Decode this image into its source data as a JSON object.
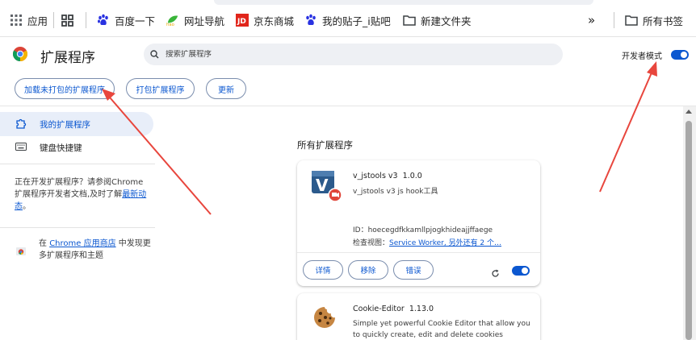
{
  "bookmarks_bar": {
    "items": [
      {
        "label": "应用"
      },
      {
        "label": ""
      },
      {
        "label": "百度一下"
      },
      {
        "label": "网址导航"
      },
      {
        "label": "京东商城"
      },
      {
        "label": "我的贴子_i贴吧"
      },
      {
        "label": "新建文件夹"
      }
    ],
    "overflow": "»",
    "all_bookmarks": "所有书签"
  },
  "header": {
    "title": "扩展程序",
    "search_placeholder": "搜索扩展程序",
    "dev_mode_label": "开发者模式",
    "dev_mode_on": true
  },
  "toolbar": {
    "load_unpacked": "加载未打包的扩展程序",
    "pack": "打包扩展程序",
    "update": "更新"
  },
  "sidebar": {
    "my_extensions": "我的扩展程序",
    "shortcuts": "键盘快捷键",
    "dev_text_1": "正在开发扩展程序？请参阅Chrome 扩展程序开发者文档,及时了解",
    "dev_link": "最新动态",
    "dev_text_2": "。",
    "store_text_1": "在",
    "store_link": "Chrome 应用商店",
    "store_text_2": "中发现更多扩展程序和主题"
  },
  "main": {
    "section_title": "所有扩展程序",
    "extensions": [
      {
        "name": "v_jstools v3",
        "version": "1.0.0",
        "description": "v_jstools v3 js hook工具",
        "id_label": "ID：",
        "id": "hoecegdfkkamllpjogkhideajjffaege",
        "inspect_label": "检查视图：",
        "inspect_link": "Service Worker, 另外还有 2 个…",
        "details": "详情",
        "remove": "移除",
        "errors": "错误",
        "enabled": true
      },
      {
        "name": "Cookie-Editor",
        "version": "1.13.0",
        "description": "Simple yet powerful Cookie Editor that allow you to quickly create, edit and delete cookies without"
      }
    ]
  },
  "colors": {
    "accent": "#0b57d0",
    "annotation_arrow": "#e8463d"
  }
}
